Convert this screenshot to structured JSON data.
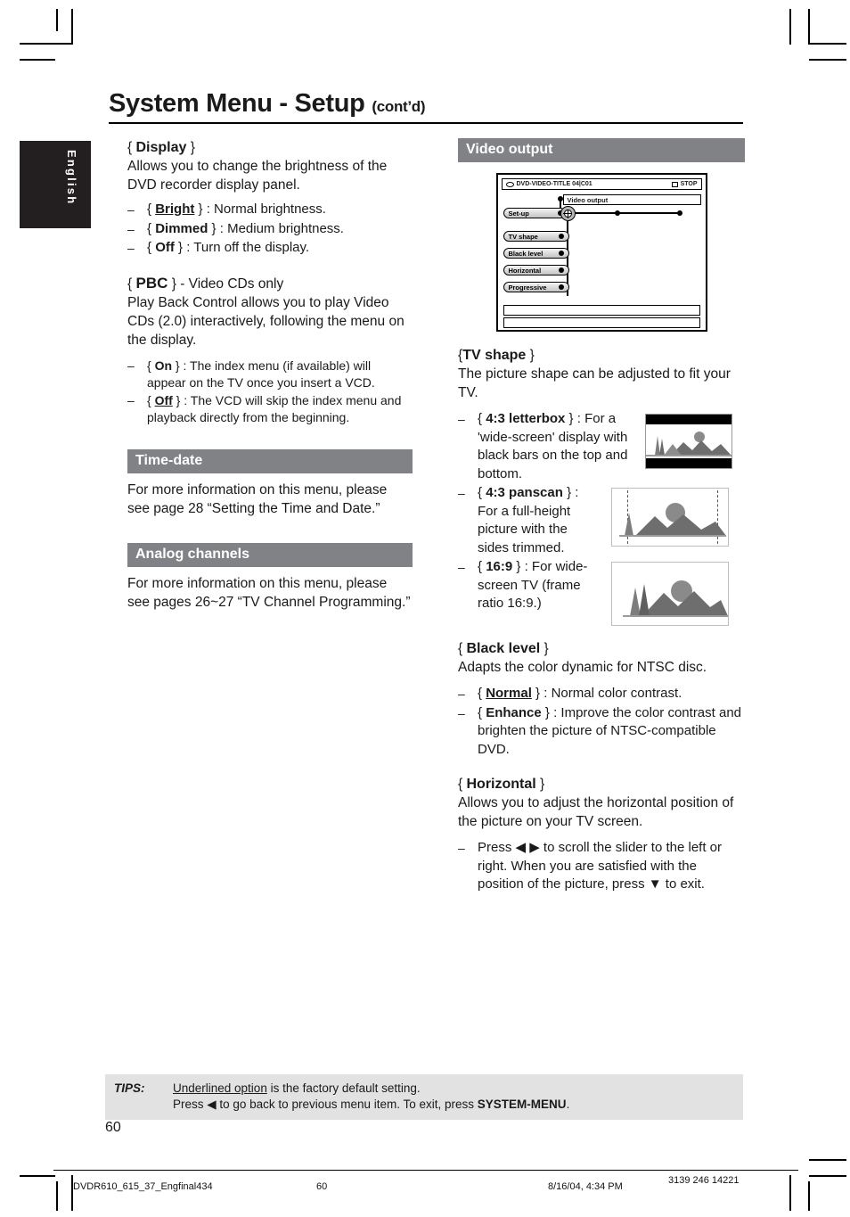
{
  "language_tab": "English",
  "header": {
    "title": "System Menu - Setup",
    "contd": "(cont’d)"
  },
  "left_column": {
    "display": {
      "heading_open": "{",
      "heading": "Display",
      "heading_close": "}",
      "intro": "Allows you to change the brightness of the DVD recorder display panel.",
      "options": [
        {
          "name": "Bright",
          "underlined": true,
          "desc": ": Normal brightness."
        },
        {
          "name": "Dimmed",
          "underlined": false,
          "desc": ": Medium brightness."
        },
        {
          "name": "Off",
          "underlined": false,
          "desc": ": Turn off the display."
        }
      ]
    },
    "pbc": {
      "heading": "PBC",
      "heading_suffix": "- Video CDs only",
      "intro": "Play Back Control allows you to play Video CDs (2.0) interactively, following the menu on the display.",
      "options": [
        {
          "name": "On",
          "underlined": false,
          "desc": ": The index menu (if available) will appear on the TV once you insert a VCD."
        },
        {
          "name": "Off",
          "underlined": true,
          "desc": ": The VCD will skip the index menu and playback directly from the beginning."
        }
      ]
    },
    "time_date": {
      "section_title": "Time-date",
      "body": "For more information on this menu, please see page 28 “Setting the Time and Date.”"
    },
    "analog_channels": {
      "section_title": "Analog channels",
      "body": "For more information on this menu, please see pages 26~27 “TV Channel Programming.”"
    }
  },
  "right_column": {
    "section_title": "Video output",
    "osd": {
      "disc_label": "DVD-VIDEO-TITLE 04|C01",
      "status_label": "STOP",
      "current_item": "Video output",
      "left_pill": "Set-up",
      "menu_items": [
        "TV shape",
        "Black level",
        "Horizontal",
        "Progressive"
      ]
    },
    "tv_shape": {
      "heading": "TV shape",
      "intro": "The picture shape can be adjusted to fit your TV.",
      "options": [
        {
          "name": "4:3 letterbox",
          "desc": ": For a 'wide-screen' display with black bars on the top and bottom."
        },
        {
          "name": "4:3 panscan",
          "desc": ": For a full-height picture with the sides trimmed."
        },
        {
          "name": "16:9",
          "desc": ": For wide-screen TV (frame ratio 16:9.)"
        }
      ]
    },
    "black_level": {
      "heading": "Black level",
      "intro": "Adapts the color dynamic for NTSC disc.",
      "options": [
        {
          "name": "Normal",
          "underlined": true,
          "desc": ": Normal color contrast."
        },
        {
          "name": "Enhance",
          "underlined": false,
          "desc": ": Improve the color contrast and brighten the picture of NTSC-compatible DVD."
        }
      ]
    },
    "horizontal": {
      "heading": "Horizontal",
      "intro": "Allows you to adjust the horizontal position of the picture on your TV screen.",
      "note": "Press ◀ ▶ to scroll the slider to the left or right. When you are satisfied with the position of the picture, press ▼ to exit."
    }
  },
  "tips": {
    "label": "TIPS:",
    "line1_underlined": "Underlined option",
    "line1_rest": " is the factory default setting.",
    "line2_pre": "Press ◀ to go back to previous menu item.  To exit, press ",
    "line2_bold": "SYSTEM-MENU",
    "line2_post": "."
  },
  "page_number": "60",
  "footer": {
    "file": "DVDR610_615_37_Engfinal434",
    "page": "60",
    "datetime": "8/16/04, 4:34 PM",
    "code": "3139 246 14221"
  },
  "colors": {
    "section_bar": "#808285",
    "lang_tab": "#231f20",
    "tips_bg": "#e2e2e2"
  }
}
